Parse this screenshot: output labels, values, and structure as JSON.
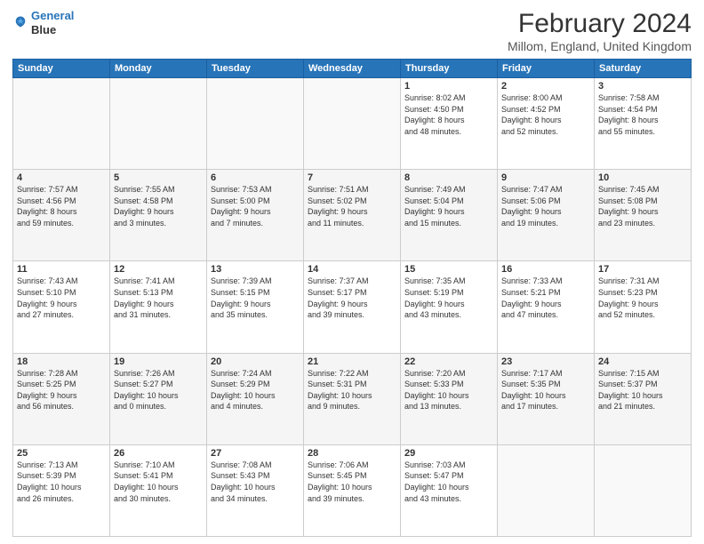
{
  "logo": {
    "line1": "General",
    "line2": "Blue"
  },
  "title": "February 2024",
  "location": "Millom, England, United Kingdom",
  "days_of_week": [
    "Sunday",
    "Monday",
    "Tuesday",
    "Wednesday",
    "Thursday",
    "Friday",
    "Saturday"
  ],
  "weeks": [
    [
      {
        "day": "",
        "info": ""
      },
      {
        "day": "",
        "info": ""
      },
      {
        "day": "",
        "info": ""
      },
      {
        "day": "",
        "info": ""
      },
      {
        "day": "1",
        "info": "Sunrise: 8:02 AM\nSunset: 4:50 PM\nDaylight: 8 hours\nand 48 minutes."
      },
      {
        "day": "2",
        "info": "Sunrise: 8:00 AM\nSunset: 4:52 PM\nDaylight: 8 hours\nand 52 minutes."
      },
      {
        "day": "3",
        "info": "Sunrise: 7:58 AM\nSunset: 4:54 PM\nDaylight: 8 hours\nand 55 minutes."
      }
    ],
    [
      {
        "day": "4",
        "info": "Sunrise: 7:57 AM\nSunset: 4:56 PM\nDaylight: 8 hours\nand 59 minutes."
      },
      {
        "day": "5",
        "info": "Sunrise: 7:55 AM\nSunset: 4:58 PM\nDaylight: 9 hours\nand 3 minutes."
      },
      {
        "day": "6",
        "info": "Sunrise: 7:53 AM\nSunset: 5:00 PM\nDaylight: 9 hours\nand 7 minutes."
      },
      {
        "day": "7",
        "info": "Sunrise: 7:51 AM\nSunset: 5:02 PM\nDaylight: 9 hours\nand 11 minutes."
      },
      {
        "day": "8",
        "info": "Sunrise: 7:49 AM\nSunset: 5:04 PM\nDaylight: 9 hours\nand 15 minutes."
      },
      {
        "day": "9",
        "info": "Sunrise: 7:47 AM\nSunset: 5:06 PM\nDaylight: 9 hours\nand 19 minutes."
      },
      {
        "day": "10",
        "info": "Sunrise: 7:45 AM\nSunset: 5:08 PM\nDaylight: 9 hours\nand 23 minutes."
      }
    ],
    [
      {
        "day": "11",
        "info": "Sunrise: 7:43 AM\nSunset: 5:10 PM\nDaylight: 9 hours\nand 27 minutes."
      },
      {
        "day": "12",
        "info": "Sunrise: 7:41 AM\nSunset: 5:13 PM\nDaylight: 9 hours\nand 31 minutes."
      },
      {
        "day": "13",
        "info": "Sunrise: 7:39 AM\nSunset: 5:15 PM\nDaylight: 9 hours\nand 35 minutes."
      },
      {
        "day": "14",
        "info": "Sunrise: 7:37 AM\nSunset: 5:17 PM\nDaylight: 9 hours\nand 39 minutes."
      },
      {
        "day": "15",
        "info": "Sunrise: 7:35 AM\nSunset: 5:19 PM\nDaylight: 9 hours\nand 43 minutes."
      },
      {
        "day": "16",
        "info": "Sunrise: 7:33 AM\nSunset: 5:21 PM\nDaylight: 9 hours\nand 47 minutes."
      },
      {
        "day": "17",
        "info": "Sunrise: 7:31 AM\nSunset: 5:23 PM\nDaylight: 9 hours\nand 52 minutes."
      }
    ],
    [
      {
        "day": "18",
        "info": "Sunrise: 7:28 AM\nSunset: 5:25 PM\nDaylight: 9 hours\nand 56 minutes."
      },
      {
        "day": "19",
        "info": "Sunrise: 7:26 AM\nSunset: 5:27 PM\nDaylight: 10 hours\nand 0 minutes."
      },
      {
        "day": "20",
        "info": "Sunrise: 7:24 AM\nSunset: 5:29 PM\nDaylight: 10 hours\nand 4 minutes."
      },
      {
        "day": "21",
        "info": "Sunrise: 7:22 AM\nSunset: 5:31 PM\nDaylight: 10 hours\nand 9 minutes."
      },
      {
        "day": "22",
        "info": "Sunrise: 7:20 AM\nSunset: 5:33 PM\nDaylight: 10 hours\nand 13 minutes."
      },
      {
        "day": "23",
        "info": "Sunrise: 7:17 AM\nSunset: 5:35 PM\nDaylight: 10 hours\nand 17 minutes."
      },
      {
        "day": "24",
        "info": "Sunrise: 7:15 AM\nSunset: 5:37 PM\nDaylight: 10 hours\nand 21 minutes."
      }
    ],
    [
      {
        "day": "25",
        "info": "Sunrise: 7:13 AM\nSunset: 5:39 PM\nDaylight: 10 hours\nand 26 minutes."
      },
      {
        "day": "26",
        "info": "Sunrise: 7:10 AM\nSunset: 5:41 PM\nDaylight: 10 hours\nand 30 minutes."
      },
      {
        "day": "27",
        "info": "Sunrise: 7:08 AM\nSunset: 5:43 PM\nDaylight: 10 hours\nand 34 minutes."
      },
      {
        "day": "28",
        "info": "Sunrise: 7:06 AM\nSunset: 5:45 PM\nDaylight: 10 hours\nand 39 minutes."
      },
      {
        "day": "29",
        "info": "Sunrise: 7:03 AM\nSunset: 5:47 PM\nDaylight: 10 hours\nand 43 minutes."
      },
      {
        "day": "",
        "info": ""
      },
      {
        "day": "",
        "info": ""
      }
    ]
  ]
}
